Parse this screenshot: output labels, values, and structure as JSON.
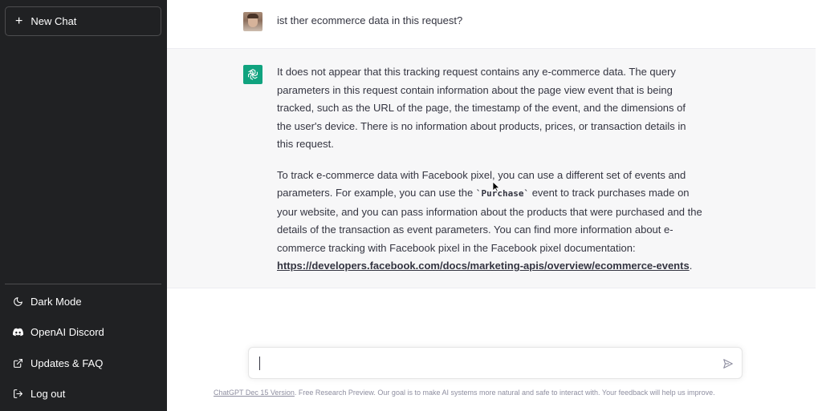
{
  "sidebar": {
    "new_chat_label": "New Chat",
    "items": [
      {
        "label": "Dark Mode",
        "icon": "moon-icon"
      },
      {
        "label": "OpenAI Discord",
        "icon": "discord-icon"
      },
      {
        "label": "Updates & FAQ",
        "icon": "external-link-icon"
      },
      {
        "label": "Log out",
        "icon": "logout-icon"
      }
    ]
  },
  "conversation": {
    "user_message": "ist ther ecommerce data in this request?",
    "assistant_paragraph_1": "It does not appear that this tracking request contains any e-commerce data. The query parameters in this request contain information about the page view event that is being tracked, such as the URL of the page, the timestamp of the event, and the dimensions of the user's device. There is no information about products, prices, or transaction details in this request.",
    "assistant_paragraph_2_before_code": "To track e-commerce data with Facebook pixel, you can use a different set of events and parameters. For example, you can use the ",
    "assistant_code": "`Purchase`",
    "assistant_paragraph_2_after_code": " event to track purchases made on your website, and you can pass information about the products that were purchased and the details of the transaction as event parameters. You can find more information about e-commerce tracking with Facebook pixel in the Facebook pixel documentation: ",
    "assistant_link": "https://developers.facebook.com/docs/marketing-apis/overview/ecommerce-events",
    "assistant_trailing": "."
  },
  "input": {
    "value": "",
    "placeholder": ""
  },
  "footer": {
    "version_link": "ChatGPT Dec 15 Version",
    "text": ". Free Research Preview. Our goal is to make AI systems more natural and safe to interact with. Your feedback will help us improve."
  },
  "colors": {
    "sidebar_bg": "#202123",
    "assistant_bg": "#f7f7f8",
    "brand_green": "#10a37f",
    "text": "#343541"
  }
}
